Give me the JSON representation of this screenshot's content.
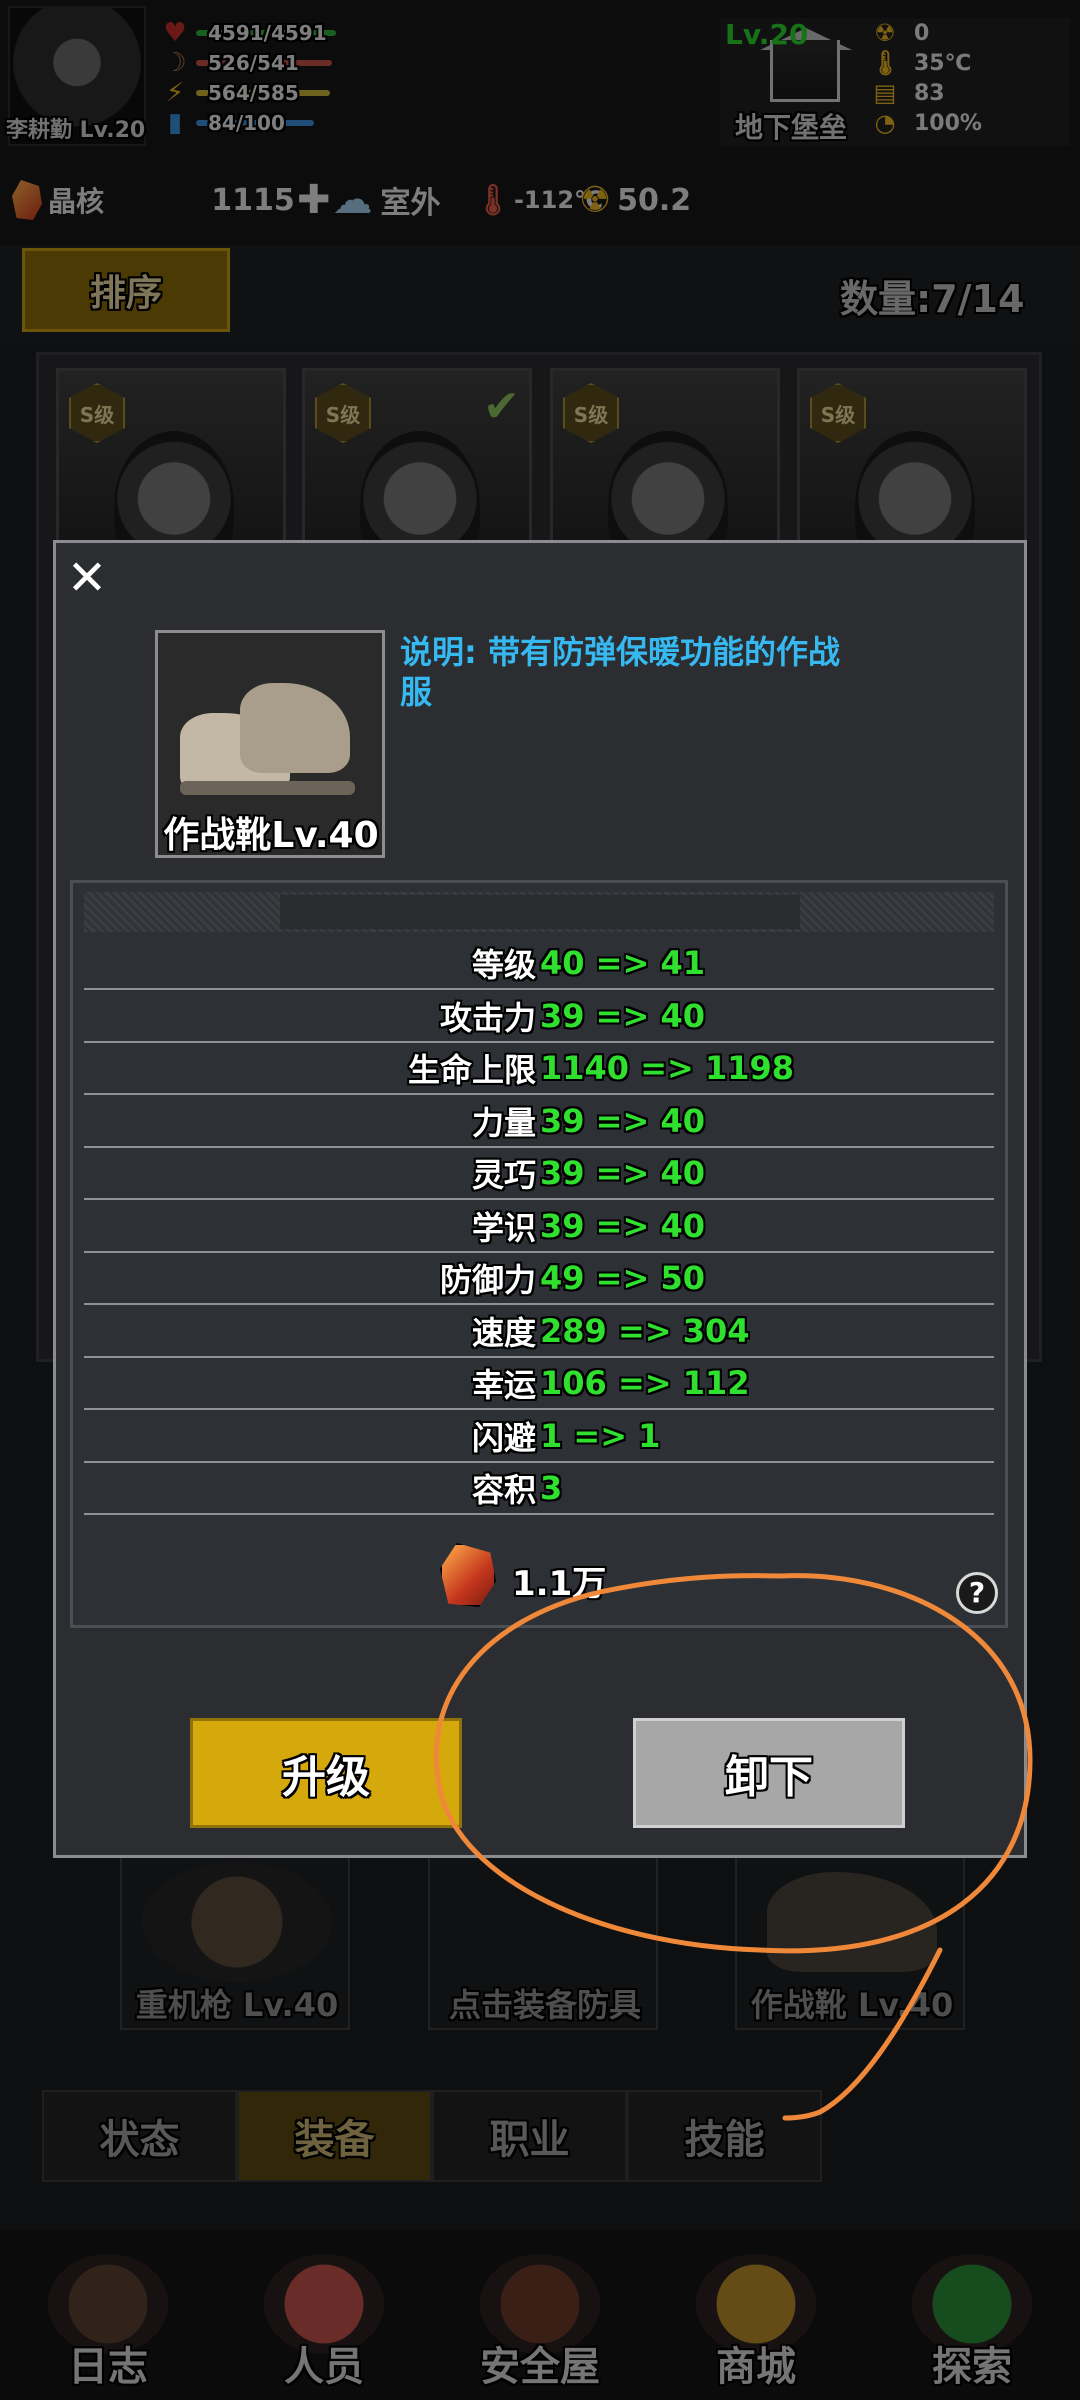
{
  "player": {
    "name_level": "李耕勤 Lv.20"
  },
  "stats": [
    {
      "icon": "heart-icon",
      "glyph": "♥",
      "color": "#c0302a",
      "value": "4591/4591",
      "bar_color": "#2fae3a",
      "fill": 1.0
    },
    {
      "icon": "stomach-icon",
      "glyph": "☽",
      "color": "#b07a5a",
      "value": "526/541",
      "bar_color": "#c4504a",
      "fill": 0.97
    },
    {
      "icon": "energy-icon",
      "glyph": "⚡",
      "color": "#e0b020",
      "value": "564/585",
      "bar_color": "#c9b23a",
      "fill": 0.96
    },
    {
      "icon": "water-icon",
      "glyph": "▮",
      "color": "#3a8fd8",
      "value": "84/100",
      "bar_color": "#3a8fd8",
      "fill": 0.84
    }
  ],
  "base": {
    "level": "Lv.20",
    "name": "地下堡垒",
    "env": [
      {
        "icon": "radiation-icon",
        "glyph": "☢",
        "value": "0"
      },
      {
        "icon": "thermometer-icon",
        "glyph": "🌡",
        "value": "35℃"
      },
      {
        "icon": "food-icon",
        "glyph": "▤",
        "value": "83"
      },
      {
        "icon": "power-icon",
        "glyph": "◔",
        "value": "100%"
      }
    ]
  },
  "resources": {
    "crystal_label": "晶核",
    "crystal_value": "1115",
    "weather": "室外",
    "temperature": "-112℃",
    "radiation": "50.2"
  },
  "list": {
    "sort_label": "排序",
    "count": "数量:7/14"
  },
  "characters": [
    {
      "grade": "S级",
      "checked": false
    },
    {
      "grade": "S级",
      "checked": true
    },
    {
      "grade": "S级",
      "checked": false
    },
    {
      "grade": "S级",
      "checked": false
    }
  ],
  "equip_slots": [
    "重机枪 Lv.40",
    "点击装备防具",
    "作战靴 Lv.40"
  ],
  "tabs": [
    "状态",
    "装备",
    "职业",
    "技能"
  ],
  "nav": [
    "日志",
    "人员",
    "安全屋",
    "商城",
    "探索"
  ],
  "modal": {
    "item_name": "作战靴Lv.40",
    "description": "说明: 带有防弹保暖功能的作战服",
    "stat_rows": [
      {
        "name": "等级",
        "value": "40  =>  41"
      },
      {
        "name": "攻击力",
        "value": "39  =>  40"
      },
      {
        "name": "生命上限",
        "value": "1140  =>  1198"
      },
      {
        "name": "力量",
        "value": "39  =>  40"
      },
      {
        "name": "灵巧",
        "value": "39  =>  40"
      },
      {
        "name": "学识",
        "value": "39  =>  40"
      },
      {
        "name": "防御力",
        "value": "49  =>  50"
      },
      {
        "name": "速度",
        "value": "289  =>  304"
      },
      {
        "name": "幸运",
        "value": "106  =>  112"
      },
      {
        "name": "闪避",
        "value": "1  =>  1"
      },
      {
        "name": "容积",
        "value": "3"
      }
    ],
    "cost": "1.1万",
    "help": "?",
    "upgrade_label": "升级",
    "unequip_label": "卸下"
  },
  "annotation_color": "#f0883a"
}
